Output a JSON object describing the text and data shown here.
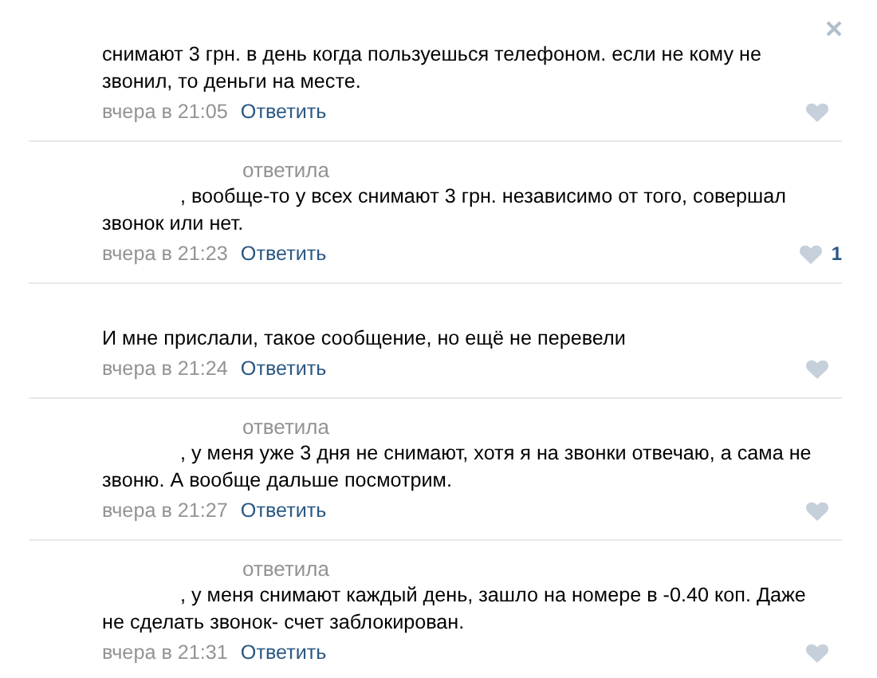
{
  "comments": [
    {
      "closable": true,
      "text": "снимают 3 грн. в день когда пользуешься телефоном. если не кому не звонил, то деньги на месте.",
      "date": "вчера в 21:05",
      "reply_link": "Ответить"
    },
    {
      "replied_label": "ответила",
      "text": ", вообще-то у всех снимают 3 грн. независимо от того, совершал звонок или нет.",
      "date": "вчера в 21:23",
      "reply_link": "Ответить",
      "likes": "1"
    },
    {
      "text": "И мне прислали, такое сообщение, но ещё не перевели",
      "date": "вчера в 21:24",
      "reply_link": "Ответить"
    },
    {
      "replied_label": "ответила",
      "text": ", у меня уже 3 дня не снимают, хотя я на звонки отвечаю, а сама не звоню. А вообще дальше посмотрим.",
      "date": "вчера в 21:27",
      "reply_link": "Ответить"
    },
    {
      "replied_label": "ответила",
      "text": ", у меня снимают каждый день, зашло на номере в -0.40 коп. Даже не сделать звонок- счет заблокирован.",
      "date": "вчера в 21:31",
      "reply_link": "Ответить"
    }
  ]
}
